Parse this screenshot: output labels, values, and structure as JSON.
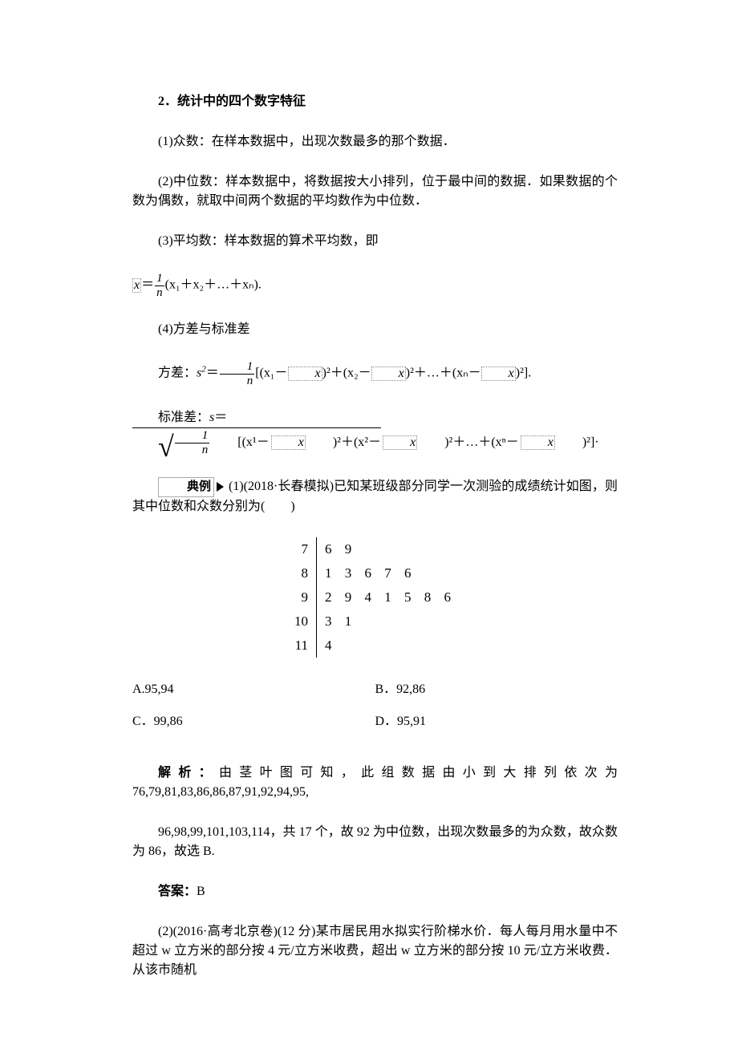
{
  "section_title": "2．统计中的四个数字特征",
  "defs": {
    "d1": "(1)众数：在样本数据中，出现次数最多的那个数据．",
    "d2": "(2)中位数：样本数据中，将数据按大小排列，位于最中间的数据．如果数据的个数为偶数，就取中间两个数据的平均数作为中位数．",
    "d3": "(3)平均数：样本数据的算术平均数，即",
    "d4": "(4)方差与标准差",
    "variance_label": "方差：",
    "sd_label": "标准差："
  },
  "formula": {
    "mean_tail": "(x₁＋x₂＋…＋xₙ).",
    "variance_tail_open": "[(x₁－",
    "variance_seg2": ")²＋(x₂－",
    "variance_seg3": ")²＋…＋(xₙ－",
    "variance_close": ")²].",
    "sd_seg1": "[(x¹－",
    "sd_seg2": ")²＋(x²－",
    "sd_seg3": ")²＋…＋(xⁿ－",
    "sd_close": ")²]·"
  },
  "dianli_label": "典例",
  "example1_text": "(1)(2018·长春模拟)已知某班级部分同学一次测验的成绩统计如图，则其中位数和众数分别为(　　)",
  "chart_data": {
    "type": "table",
    "description": "stem-and-leaf plot",
    "stems": [
      7,
      8,
      9,
      10,
      11
    ],
    "leaves": {
      "7": [
        6,
        9
      ],
      "8": [
        1,
        3,
        6,
        7,
        6
      ],
      "9": [
        2,
        9,
        4,
        1,
        5,
        8,
        6
      ],
      "10": [
        3,
        1
      ],
      "11": [
        4
      ]
    },
    "flattened_sorted": [
      76,
      79,
      81,
      83,
      86,
      86,
      87,
      91,
      92,
      94,
      95,
      96,
      98,
      99,
      101,
      103,
      114
    ]
  },
  "options": {
    "a": "A.95,94",
    "b": "B．92,86",
    "c": "C．99,86",
    "d": "D．95,91"
  },
  "jiexi_label": "解析：",
  "jiexi_line1": "由茎叶图可知，此组数据由小到大排列依次为 76,79,81,83,86,86,87,91,92,94,95,",
  "jiexi_line2": "96,98,99,101,103,114，共 17 个，故 92 为中位数，出现次数最多的为众数，故众数为 86，故选 B.",
  "answer_label": "答案：",
  "answer_value": "B",
  "example2_text": "(2)(2016·高考北京卷)(12 分)某市居民用水拟实行阶梯水价．每人每月用水量中不超过 w 立方米的部分按 4 元/立方米收费，超出 w 立方米的部分按 10 元/立方米收费．从该市随机"
}
